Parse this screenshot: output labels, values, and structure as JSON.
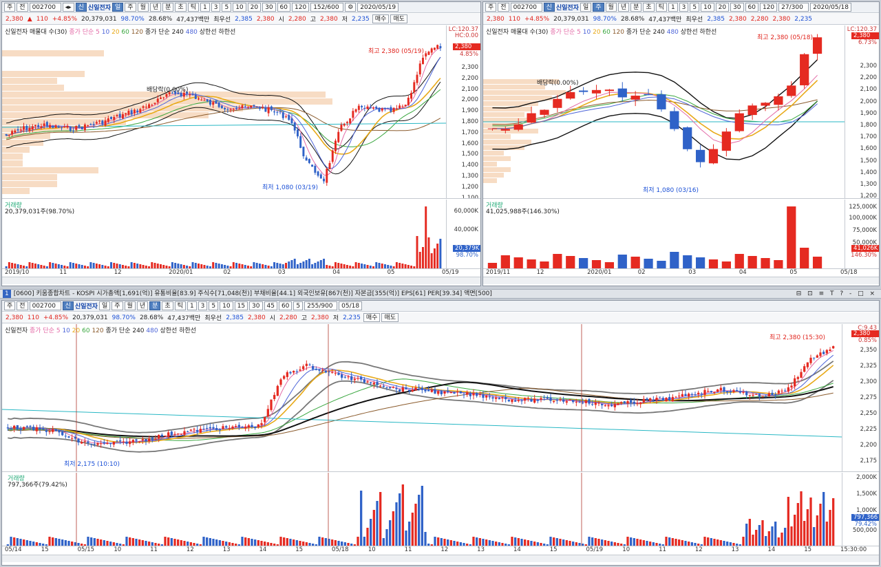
{
  "stock": {
    "code": "002700",
    "name": "신일전자",
    "price": "2,380",
    "arrow": "▲",
    "change": "110",
    "rate": "+4.85%",
    "volume": "20,379,031",
    "ratio1": "98.70%",
    "ratio2": "28.68%",
    "amount": "47,437백만",
    "pref_label": "최우선",
    "ask": "2,385",
    "bid": "2,380",
    "open_l": "시",
    "open": "2,280",
    "high_l": "고",
    "high": "2,380",
    "low_l": "저",
    "low": "2,235",
    "buy": "매수",
    "sell": "매도"
  },
  "controls": {
    "main_btn": "주",
    "jeon": "전",
    "periods": [
      "일",
      "주",
      "월",
      "년",
      "분",
      "초",
      "틱"
    ],
    "nums": [
      "1",
      "3",
      "5",
      "10",
      "20",
      "30",
      "60",
      "120"
    ],
    "nums_bottom": [
      "1",
      "3",
      "5",
      "10",
      "15",
      "30",
      "45",
      "60"
    ],
    "sel_bottom": "5",
    "cnt_tl": "152/600",
    "cnt_tr": "27/300",
    "cnt_b": "255/900",
    "date_tl": "2020/05/19",
    "date_tr": "2020/05/18",
    "date_b": "05/18",
    "shin": "신"
  },
  "charts": {
    "tl": {
      "legend": [
        "신일전자 매물대 수(30)",
        "종가 단순 5",
        "10",
        "20",
        "60",
        "120",
        "종가 단순 240",
        "480",
        "상한선",
        "하한선"
      ],
      "lc": "LC:120.37",
      "hc": "HC:0.00",
      "ticks": [
        "2,300",
        "2,200",
        "2,100",
        "2,000",
        "1,900",
        "1,800",
        "1,700",
        "1,600",
        "1,500",
        "1,400",
        "1,300",
        "1,200",
        "1,100"
      ],
      "price_tag": "2,380",
      "price_pct": "4.85%",
      "high_note": "최고 2,380 (05/19)",
      "low_note": "최저 1,080 (03/19)",
      "div_note": "배당락(0.00%)",
      "vol_title": "거래량",
      "vol_value": "20,379,031주(98.70%)",
      "vol_ticks": [
        "60,000K",
        "40,000K",
        "20,000K"
      ],
      "vol_tag": "20,379K",
      "vol_pct": "98.70%",
      "dates": [
        "2019/10",
        "11",
        "12",
        "2020/01",
        "02",
        "03",
        "04",
        "05",
        "05/19"
      ]
    },
    "tr": {
      "legend": [
        "신일전자 매물대 수(30)",
        "종가 단순 5",
        "10",
        "20",
        "60",
        "120",
        "종가 단순 240",
        "480",
        "상한선",
        "하한선"
      ],
      "lc": "LC:120.37",
      "ticks": [
        "2,300",
        "2,200",
        "2,100",
        "2,000",
        "1,900",
        "1,800",
        "1,700",
        "1,600",
        "1,500",
        "1,400",
        "1,300",
        "1,200",
        "1,100"
      ],
      "price_tag": "2,380",
      "price_pct": "6.73%",
      "high_note": "최고 2,380 (05/18)",
      "low_note": "최저 1,080 (03/16)",
      "div_note": "배당락(0.00%)",
      "vol_title": "거래량",
      "vol_value": "41,025,988주(146.30%)",
      "vol_ticks": [
        "125,000K",
        "100,000K",
        "75,000K",
        "50,000K"
      ],
      "vol_tag": "41,026K",
      "vol_pct": "146.30%",
      "dates": [
        "2019/11",
        "12",
        "2020/01",
        "02",
        "03",
        "04",
        "05",
        "05/18"
      ]
    },
    "b": {
      "legend": [
        "신일전자",
        "종가 단순 5",
        "10",
        "20",
        "60",
        "120",
        "종가 단순 240",
        "480",
        "상한선",
        "하한선"
      ],
      "lc": "C:9.43",
      "ticks": [
        "2,350",
        "2,325",
        "2,300",
        "2,275",
        "2,250",
        "2,225",
        "2,200",
        "2,175"
      ],
      "price_tag": "2,380",
      "price_pct": "0.85%",
      "high_note": "최고 2,380 (15:30)",
      "low_note": "최저 2,175 (10:10)",
      "vol_title": "거래량",
      "vol_value": "797,366주(79.42%)",
      "vol_ticks": [
        "2,000K",
        "1,500K",
        "1,000K",
        "500,000"
      ],
      "vol_tag": "797,366",
      "vol_pct": "79.42%",
      "dates": [
        "05/14",
        "15",
        "05/15",
        "10",
        "11",
        "12",
        "13",
        "14",
        "15",
        "05/18",
        "10",
        "11",
        "12",
        "13",
        "14",
        "15",
        "05/19",
        "10",
        "11",
        "12",
        "13",
        "14",
        "15",
        "15:30:00"
      ]
    }
  },
  "midbar": {
    "no": "1",
    "title": "[0600] 키움종합차트 - KOSPI 시가총액[1,691(억)] 유통비율[83.9] 주식수[71,048(천)] 부채비율[44.1] 외국인보유[867(천)] 자본금[355(억)] EPS[61] PER[39.34] 액면[500]",
    "icons": "⊟ ⊡ ≡ T ? - □ ×"
  },
  "colors": {
    "up": "#e52a21",
    "down": "#2f62c8",
    "ma5": "#e36aa6",
    "ma10": "#4b63d8",
    "ma20": "#e8a917",
    "ma60": "#38a63e",
    "ma120": "#8a5a2b",
    "band": "#222222",
    "vp": "#f7dcc4"
  }
}
